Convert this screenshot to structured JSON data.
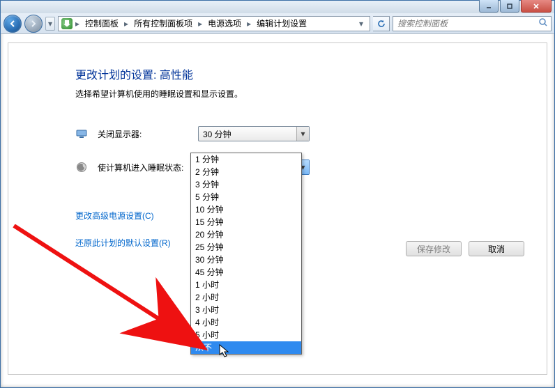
{
  "window": {
    "minimize": "–",
    "maximize": "□",
    "close": "×"
  },
  "breadcrumb": {
    "items": [
      "控制面板",
      "所有控制面板项",
      "电源选项",
      "编辑计划设置"
    ]
  },
  "search": {
    "placeholder": "搜索控制面板"
  },
  "page": {
    "title": "更改计划的设置: 高性能",
    "subtitle": "选择希望计算机使用的睡眠设置和显示设置。",
    "turn_off_display_label": "关闭显示器:",
    "turn_off_display_value": "30 分钟",
    "sleep_label": "使计算机进入睡眠状态:",
    "sleep_value": "从不",
    "link_advanced": "更改高级电源设置(C)",
    "link_restore": "还原此计划的默认设置(R)"
  },
  "buttons": {
    "save": "保存修改",
    "cancel": "取消"
  },
  "dropdown": {
    "options": [
      "1 分钟",
      "2 分钟",
      "3 分钟",
      "5 分钟",
      "10 分钟",
      "15 分钟",
      "20 分钟",
      "25 分钟",
      "30 分钟",
      "45 分钟",
      "1 小时",
      "2 小时",
      "3 小时",
      "4 小时",
      "5 小时",
      "从不"
    ],
    "highlighted_index": 15
  }
}
